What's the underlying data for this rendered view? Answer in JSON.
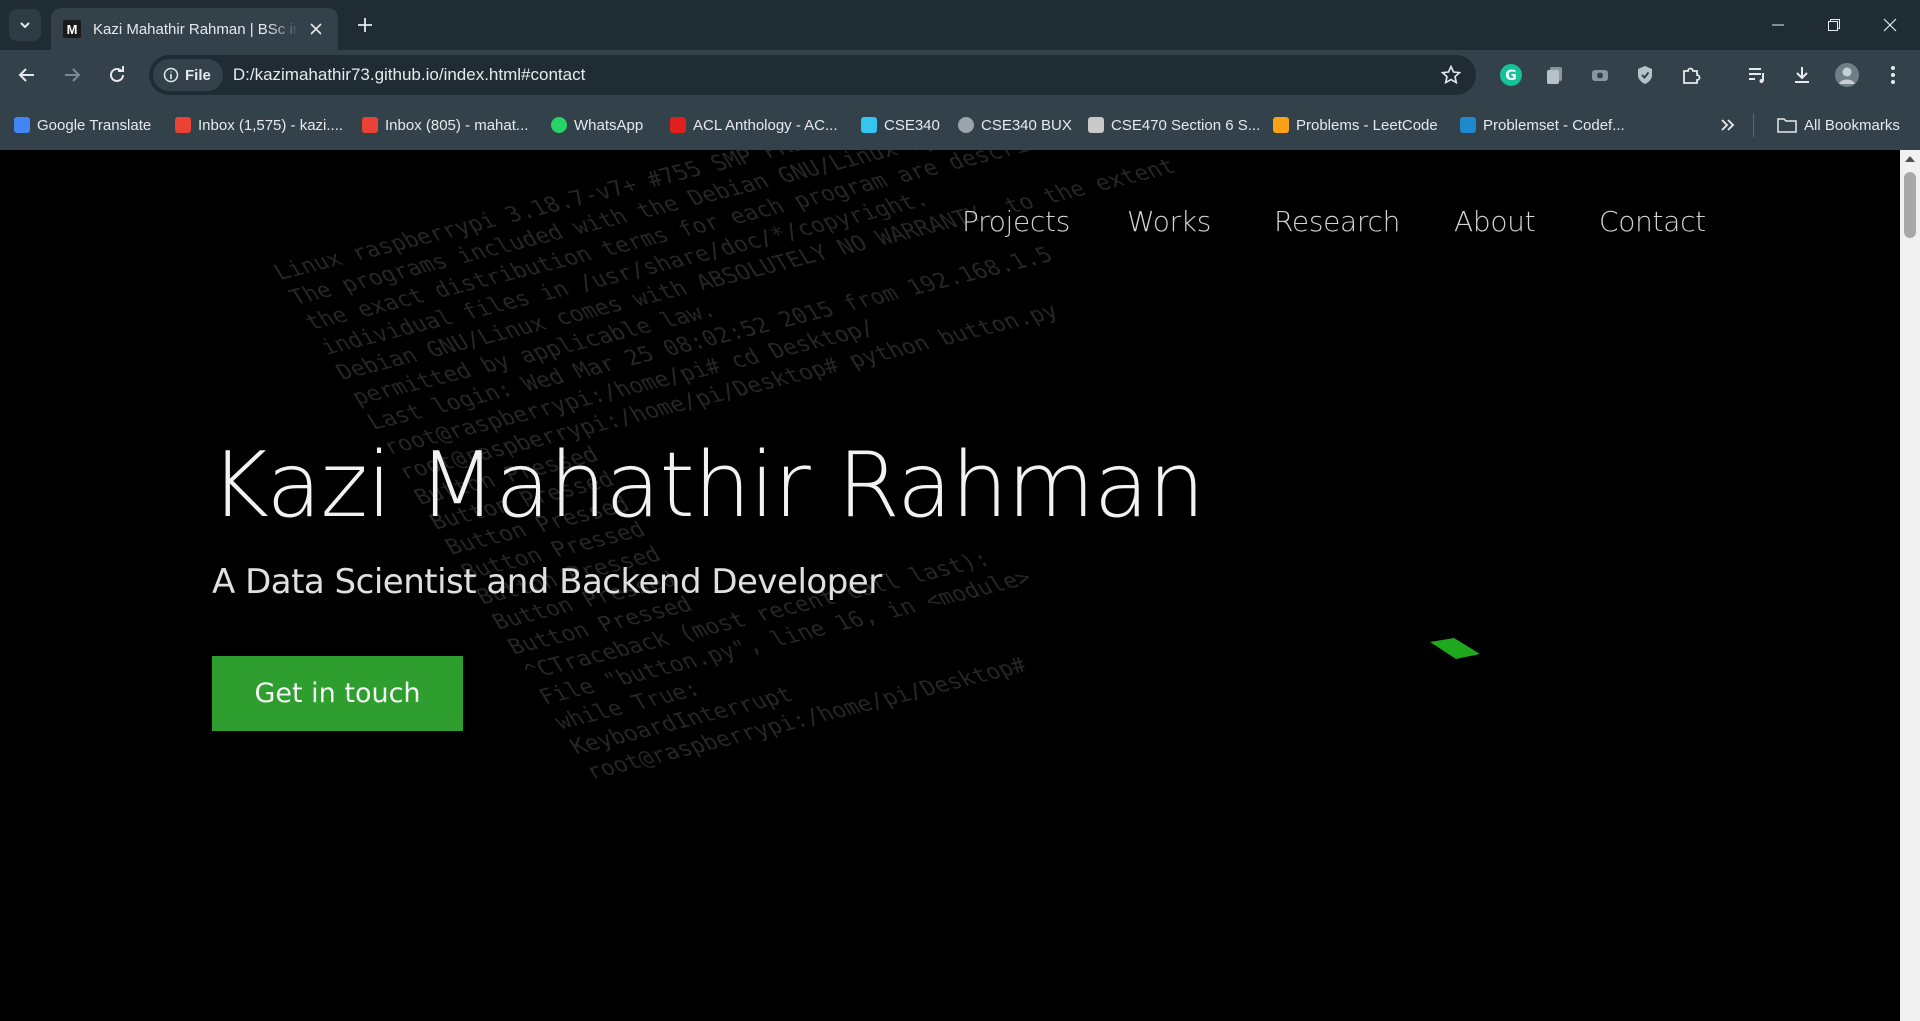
{
  "browser": {
    "tab": {
      "favicon_letter": "M",
      "title": "Kazi Mahathir Rahman | BSc in Computer Science"
    },
    "address": {
      "chip_label": "File",
      "url": "D:/kazimahathir73.github.io/index.html#contact"
    },
    "bookmarks": [
      {
        "label": "Google Translate",
        "icon": "google-translate-icon",
        "color": "#4285f4"
      },
      {
        "label": "Inbox (1,575) - kazi....",
        "icon": "gmail-icon",
        "color": "#ea4335"
      },
      {
        "label": "Inbox (805) - mahat...",
        "icon": "gmail-icon",
        "color": "#ea4335"
      },
      {
        "label": "WhatsApp",
        "icon": "whatsapp-icon",
        "color": "#25d366"
      },
      {
        "label": "ACL Anthology - AC...",
        "icon": "acl-icon",
        "color": "#e0201c"
      },
      {
        "label": "CSE340",
        "icon": "slack-icon",
        "color": "#36c5f0"
      },
      {
        "label": "CSE340 BUX",
        "icon": "bux-icon",
        "color": "#9aa5ab"
      },
      {
        "label": "CSE470 Section 6 S...",
        "icon": "classroom-icon",
        "color": "#c9c9c9"
      },
      {
        "label": "Problems - LeetCode",
        "icon": "leetcode-icon",
        "color": "#ffa116"
      },
      {
        "label": "Problemset - Codef...",
        "icon": "codeforces-icon",
        "color": "#1f8acb"
      }
    ],
    "all_bookmarks_label": "All Bookmarks"
  },
  "site": {
    "nav": [
      "Projects",
      "Works",
      "Research",
      "About",
      "Contact"
    ],
    "hero": {
      "name": "Kazi Mahathir Rahman",
      "subtitle": "A Data Scientist and Backend Developer",
      "cta_label": "Get in touch"
    },
    "accent_color": "#2e9e2e"
  }
}
